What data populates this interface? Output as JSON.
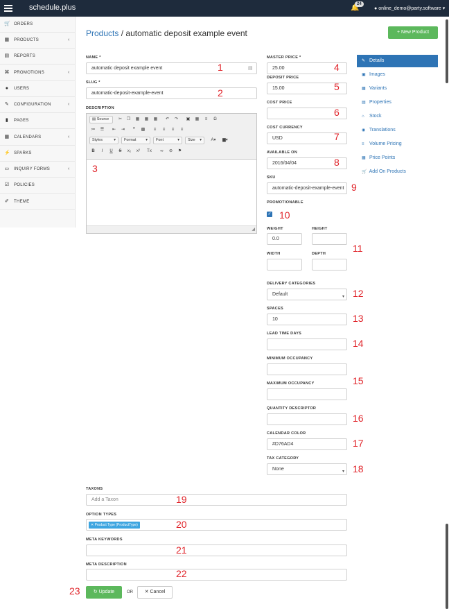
{
  "topbar": {
    "brand": "schedule.plus",
    "notifications": "24",
    "user": "online_demo@party.software"
  },
  "sidebar": {
    "items": [
      {
        "label": "ORDERS",
        "icon": "cart-icon",
        "glyph": "🛒",
        "chevron": false
      },
      {
        "label": "PRODUCTS",
        "icon": "grid-icon",
        "glyph": "▦",
        "chevron": true
      },
      {
        "label": "REPORTS",
        "icon": "file-icon",
        "glyph": "▤",
        "chevron": false
      },
      {
        "label": "PROMOTIONS",
        "icon": "gift-icon",
        "glyph": "⌘",
        "chevron": true
      },
      {
        "label": "USERS",
        "icon": "user-icon",
        "glyph": "●",
        "chevron": false
      },
      {
        "label": "CONFIGURATION",
        "icon": "wrench-icon",
        "glyph": "✎",
        "chevron": true
      },
      {
        "label": "PAGES",
        "icon": "page-icon",
        "glyph": "▮",
        "chevron": false
      },
      {
        "label": "CALENDARS",
        "icon": "calendar-icon",
        "glyph": "▦",
        "chevron": true
      },
      {
        "label": "SPARKS",
        "icon": "bolt-icon",
        "glyph": "⚡",
        "chevron": false
      },
      {
        "label": "INQUIRY FORMS",
        "icon": "form-icon",
        "glyph": "▭",
        "chevron": true
      },
      {
        "label": "POLICIES",
        "icon": "check-icon",
        "glyph": "☑",
        "chevron": false
      },
      {
        "label": "THEME",
        "icon": "brush-icon",
        "glyph": "✐",
        "chevron": false
      }
    ]
  },
  "header": {
    "crumb": "Products",
    "separator": "/",
    "title": "automatic deposit example event",
    "new_button": "New Product"
  },
  "form": {
    "name_label": "NAME *",
    "name_value": "automatic deposit example event",
    "slug_label": "SLUG *",
    "slug_value": "automatic-deposit-example-event",
    "description_label": "DESCRIPTION",
    "master_price_label": "MASTER PRICE *",
    "master_price_value": "25.00",
    "deposit_price_label": "DEPOSIT PRICE",
    "deposit_price_value": "15.00",
    "cost_price_label": "COST PRICE",
    "cost_price_value": "",
    "cost_currency_label": "COST CURRENCY",
    "cost_currency_value": "USD",
    "available_on_label": "AVAILABLE ON",
    "available_on_value": "2016/04/04",
    "sku_label": "SKU",
    "sku_value": "automatic-deposit-example-event",
    "promotionable_label": "PROMOTIONABLE",
    "weight_label": "WEIGHT",
    "weight_value": "0.0",
    "height_label": "HEIGHT",
    "width_label": "WIDTH",
    "depth_label": "DEPTH",
    "delivery_label": "DELIVERY CATEGORIES",
    "delivery_value": "Default",
    "spaces_label": "SPACES",
    "spaces_value": "10",
    "lead_label": "LEAD TIME DAYS",
    "min_occ_label": "MINIMUM OCCUPANCY",
    "max_occ_label": "MAXIMUM OCCUPANCY",
    "qty_desc_label": "QUANTITY DESCRIPTOR",
    "cal_color_label": "CALENDAR COLOR",
    "cal_color_value": "#D76AD4",
    "tax_label": "TAX CATEGORY",
    "tax_value": "None",
    "taxons_label": "TAXONS",
    "taxons_placeholder": "Add a Taxon",
    "option_types_label": "OPTION TYPES",
    "option_tag": "✕ Product Type (ProductType)",
    "meta_keywords_label": "META KEYWORDS",
    "meta_description_label": "META DESCRIPTION",
    "update_button": "Update",
    "or_text": "OR",
    "cancel_button": "Cancel"
  },
  "editor": {
    "source_label": "Source",
    "styles": "Styles",
    "format": "Format",
    "font": "Font",
    "size": "Size"
  },
  "tabs": [
    {
      "label": "Details",
      "glyph": "✎"
    },
    {
      "label": "Images",
      "glyph": "▣"
    },
    {
      "label": "Variants",
      "glyph": "▦"
    },
    {
      "label": "Properties",
      "glyph": "▤"
    },
    {
      "label": "Stock",
      "glyph": "⌂"
    },
    {
      "label": "Translations",
      "glyph": "◉"
    },
    {
      "label": "Volume Pricing",
      "glyph": "≡"
    },
    {
      "label": "Price Points",
      "glyph": "▦"
    },
    {
      "label": "Add On Products",
      "glyph": "🛒"
    }
  ],
  "annotations": [
    "1",
    "2",
    "3",
    "4",
    "5",
    "6",
    "7",
    "8",
    "9",
    "10",
    "11",
    "12",
    "13",
    "14",
    "15",
    "16",
    "17",
    "18",
    "19",
    "20",
    "21",
    "22",
    "23"
  ],
  "colors": {
    "topbar": "#1e2b3c",
    "accent": "#2e74b5",
    "success": "#5cb85c",
    "annotation": "#e0242a"
  }
}
